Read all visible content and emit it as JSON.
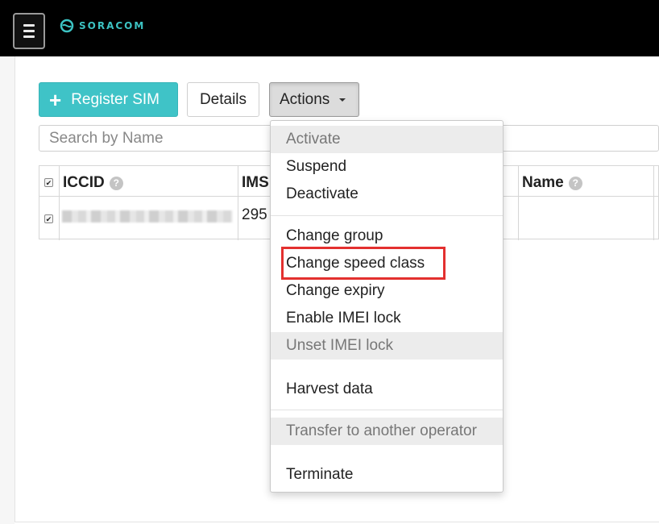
{
  "brand": {
    "name": "SORACOM",
    "accent": "#3fc3c7"
  },
  "toolbar": {
    "register_label": "Register SIM",
    "register_icon": "plus-icon",
    "details_label": "Details",
    "actions_label": "Actions"
  },
  "search": {
    "placeholder": "Search by Name"
  },
  "table": {
    "columns": [
      "ICCID",
      "IMS",
      "Name"
    ],
    "help_glyph": "?",
    "row": {
      "iccid_redacted": true,
      "imsi_partial": "295"
    }
  },
  "actions_menu": {
    "items": [
      {
        "label": "Activate",
        "disabled": true
      },
      {
        "label": "Suspend",
        "disabled": false
      },
      {
        "label": "Deactivate",
        "disabled": false
      },
      {
        "label": "Change group",
        "disabled": false
      },
      {
        "label": "Change speed class",
        "disabled": false,
        "highlighted": true
      },
      {
        "label": "Change expiry",
        "disabled": false
      },
      {
        "label": "Enable IMEI lock",
        "disabled": false
      },
      {
        "label": "Unset IMEI lock",
        "disabled": true
      },
      {
        "label": "Harvest data",
        "disabled": false
      },
      {
        "label": "Transfer to another operator",
        "disabled": true
      },
      {
        "label": "Terminate",
        "disabled": false
      }
    ],
    "highlight_color": "#e3302f"
  }
}
